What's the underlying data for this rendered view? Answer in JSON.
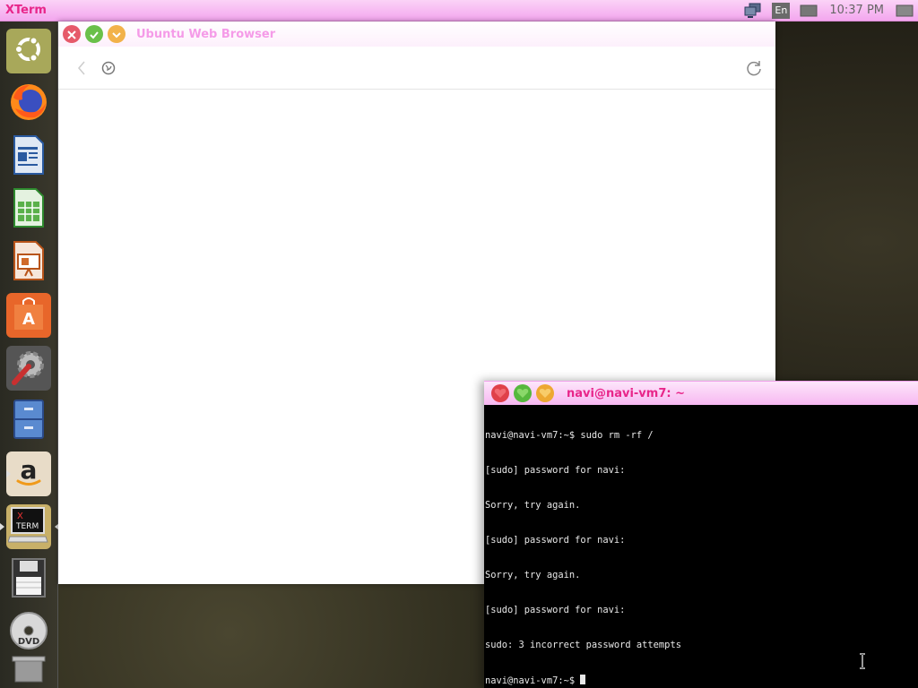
{
  "top_panel": {
    "app_name": "XTerm",
    "language": "En",
    "clock": "10:37 PM"
  },
  "launcher": {
    "items": [
      {
        "name": "ubuntu-dash",
        "icon": "ubuntu-logo-icon"
      },
      {
        "name": "firefox",
        "icon": "firefox-icon"
      },
      {
        "name": "libreoffice-writer",
        "icon": "writer-icon"
      },
      {
        "name": "libreoffice-calc",
        "icon": "calc-icon"
      },
      {
        "name": "libreoffice-impress",
        "icon": "impress-icon"
      },
      {
        "name": "ubuntu-software",
        "icon": "software-center-icon"
      },
      {
        "name": "system-settings",
        "icon": "settings-icon"
      },
      {
        "name": "files",
        "icon": "file-cabinet-icon"
      },
      {
        "name": "amazon",
        "icon": "amazon-icon"
      },
      {
        "name": "xterm",
        "icon": "xterm-icon",
        "label": "X TERM"
      },
      {
        "name": "save",
        "icon": "floppy-icon"
      },
      {
        "name": "dvd",
        "icon": "dvd-icon",
        "label": "DVD"
      },
      {
        "name": "trash",
        "icon": "trash-icon"
      }
    ]
  },
  "browser": {
    "title": "Ubuntu Web Browser"
  },
  "xterm": {
    "title": "navi@navi-vm7: ~",
    "lines": [
      "navi@navi-vm7:~$ sudo rm -rf /",
      "[sudo] password for navi:",
      "Sorry, try again.",
      "[sudo] password for navi:",
      "Sorry, try again.",
      "[sudo] password for navi:",
      "sudo: 3 incorrect password attempts"
    ],
    "prompt": "navi@navi-vm7:~$ "
  }
}
